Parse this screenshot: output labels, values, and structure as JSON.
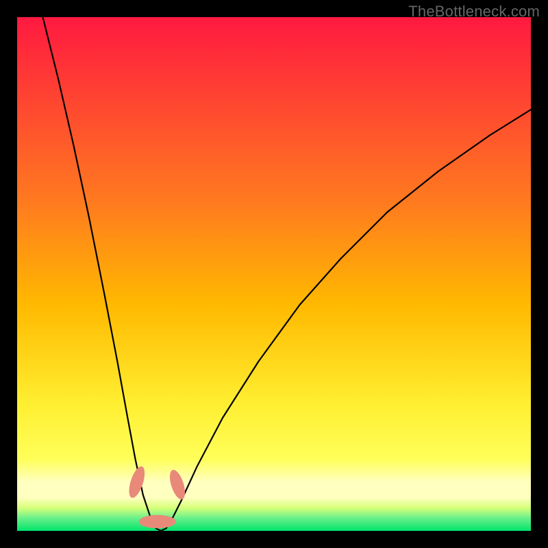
{
  "watermark": "TheBottleneck.com",
  "chart_data": {
    "type": "line",
    "title": "",
    "xlabel": "",
    "ylabel": "",
    "xlim": [
      0,
      100
    ],
    "ylim": [
      0,
      100
    ],
    "annotations": [],
    "background_gradient": {
      "top_color": "#ff1940",
      "mid_color_1": "#ffb900",
      "mid_color_2": "#ffff59",
      "bottom_color": "#00e56b",
      "pale_band_color": "#ffffc0"
    },
    "series": [
      {
        "name": "bottleneck-curve",
        "description": "V-shaped curve; y is high at left, drops to ~0 near x≈25, rises again toward right",
        "x": [
          5,
          8,
          11,
          14,
          17,
          19.5,
          21.5,
          23,
          24.5,
          26,
          27,
          28,
          29,
          30,
          32,
          35,
          40,
          47,
          55,
          63,
          72,
          82,
          92,
          100
        ],
        "y": [
          100,
          88,
          75,
          61,
          46,
          33,
          22,
          14,
          7,
          2.5,
          0.5,
          0,
          0.5,
          2,
          6,
          12.5,
          22,
          33,
          44,
          53,
          62,
          70,
          77,
          82
        ]
      }
    ],
    "markers": [
      {
        "name": "marker-left-upper",
        "cx": 23.3,
        "cy": 9.5,
        "rx": 1.2,
        "ry": 3.2,
        "rot": 18
      },
      {
        "name": "marker-right-upper",
        "cx": 31.2,
        "cy": 9.0,
        "rx": 1.2,
        "ry": 3.0,
        "rot": -18
      },
      {
        "name": "marker-bottom",
        "cx": 27.3,
        "cy": 1.8,
        "rx": 3.6,
        "ry": 1.3,
        "rot": 0
      }
    ]
  }
}
